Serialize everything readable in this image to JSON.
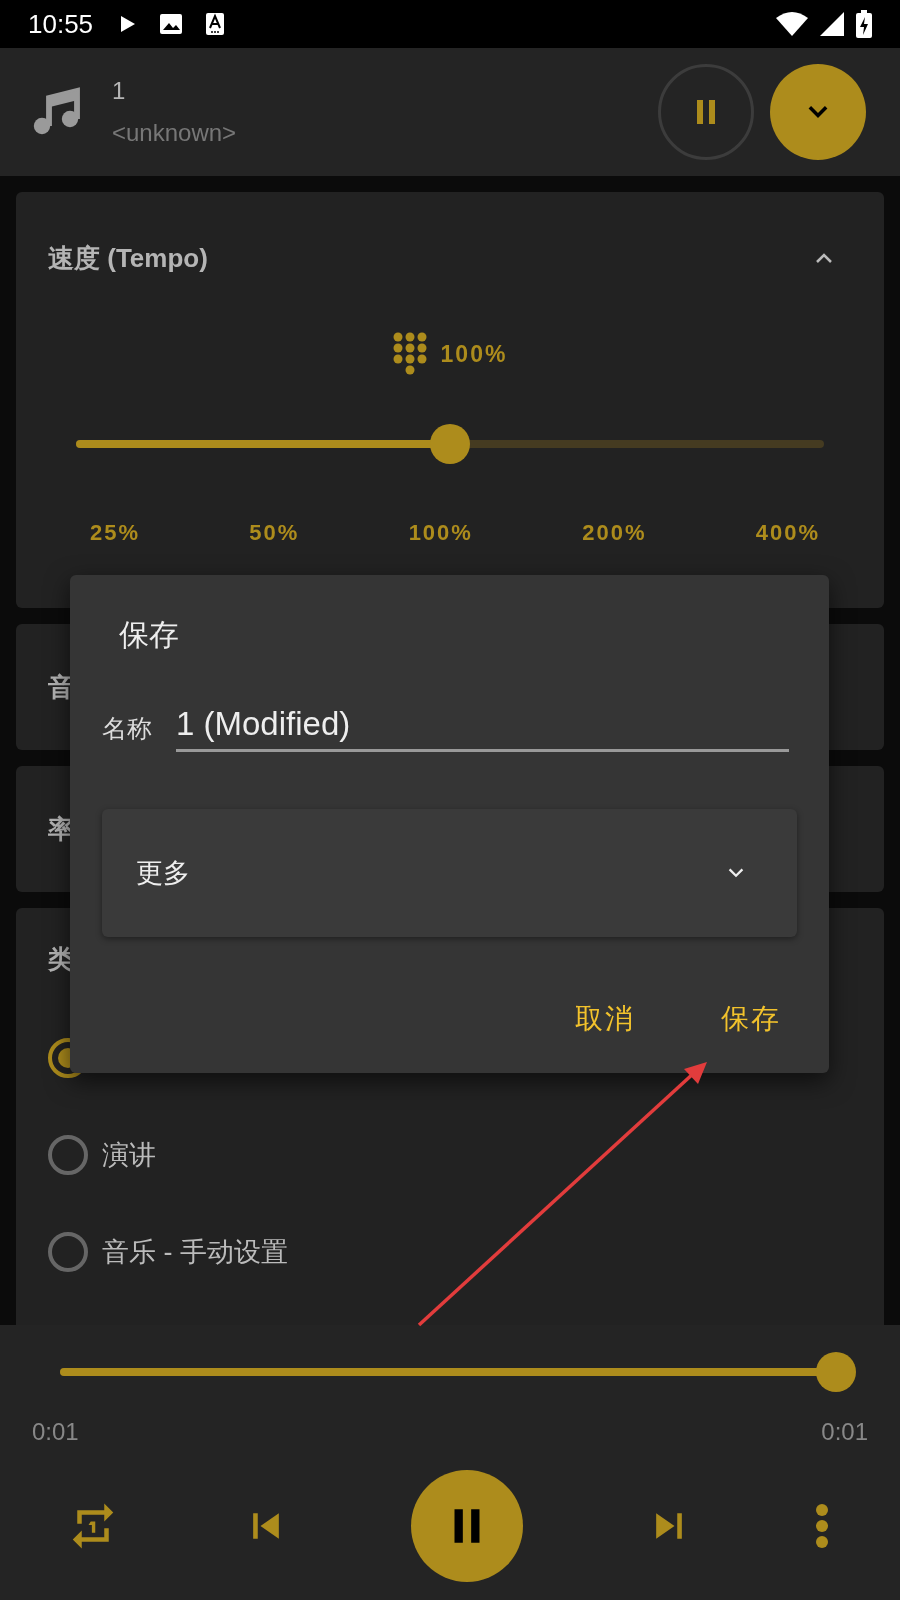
{
  "status_bar": {
    "time": "10:55"
  },
  "now_playing": {
    "title": "1",
    "artist": "<unknown>",
    "playing": true
  },
  "tempo": {
    "title": "速度 (Tempo)",
    "expanded": true,
    "value": "100%",
    "level": 0.5,
    "ticks": [
      "25%",
      "50%",
      "100%",
      "200%",
      "400%"
    ]
  },
  "sections": [
    {
      "title": "音"
    },
    {
      "title": "率"
    }
  ],
  "type_section": {
    "title": "类",
    "options": [
      {
        "selected": true
      },
      {
        "label": "演讲",
        "selected": false
      },
      {
        "label": "音乐 - 手动设置",
        "selected": false
      }
    ]
  },
  "dialog": {
    "title": "保存",
    "name_label": "名称",
    "name_value": "1 (Modified)",
    "more": {
      "label": "更多",
      "expanded": false
    },
    "buttons": [
      "取消",
      "保存"
    ]
  },
  "player": {
    "level": 1,
    "elapsed": "0:01",
    "duration": "0:01",
    "playing": true
  }
}
